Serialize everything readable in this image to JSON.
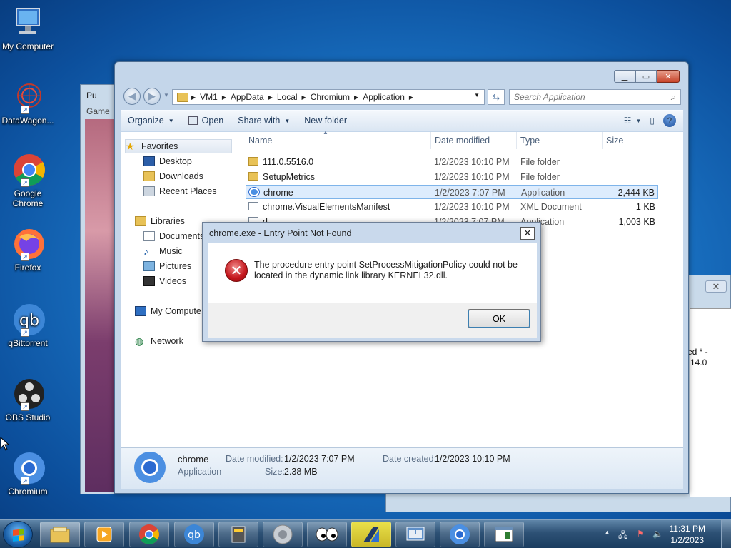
{
  "desktop": {
    "icons": [
      {
        "label": "My Computer"
      },
      {
        "label": "DataWagon..."
      },
      {
        "label": "Google Chrome"
      },
      {
        "label": "Firefox"
      },
      {
        "label": "qBittorrent"
      },
      {
        "label": "OBS Studio"
      },
      {
        "label": "Chromium"
      }
    ]
  },
  "bg_window_left": {
    "title": "Pu",
    "tab": "Game"
  },
  "bg_window_right": {
    "text1": "ed * -",
    "text2": "14.0"
  },
  "explorer": {
    "address": {
      "crumbs": [
        "VM1",
        "AppData",
        "Local",
        "Chromium",
        "Application"
      ]
    },
    "search_placeholder": "Search Application",
    "toolbar": {
      "organize": "Organize",
      "open": "Open",
      "share_with": "Share with",
      "new_folder": "New folder"
    },
    "nav": {
      "favorites": "Favorites",
      "desktop": "Desktop",
      "downloads": "Downloads",
      "recent_places": "Recent Places",
      "libraries": "Libraries",
      "documents": "Documents",
      "music": "Music",
      "pictures": "Pictures",
      "videos": "Videos",
      "my_computer": "My Compute",
      "network": "Network"
    },
    "columns": {
      "name": "Name",
      "date": "Date modified",
      "type": "Type",
      "size": "Size"
    },
    "files": [
      {
        "name": "111.0.5516.0",
        "date": "1/2/2023 10:10 PM",
        "type": "File folder",
        "size": ""
      },
      {
        "name": "SetupMetrics",
        "date": "1/2/2023 10:10 PM",
        "type": "File folder",
        "size": ""
      },
      {
        "name": "chrome",
        "date": "1/2/2023 7:07 PM",
        "type": "Application",
        "size": "2,444 KB"
      },
      {
        "name": "chrome.VisualElementsManifest",
        "date": "1/2/2023 10:10 PM",
        "type": "XML Document",
        "size": "1 KB"
      },
      {
        "name": "d",
        "date": "1/2/2023 7:07 PM",
        "type": "Application",
        "size": "1,003 KB"
      }
    ],
    "details": {
      "name": "chrome",
      "type": "Application",
      "modified_label": "Date modified:",
      "modified": "1/2/2023 7:07 PM",
      "created_label": "Date created:",
      "created": "1/2/2023 10:10 PM",
      "size_label": "Size:",
      "size": "2.38 MB"
    }
  },
  "dialog": {
    "title": "chrome.exe - Entry Point Not Found",
    "message": "The procedure entry point SetProcessMitigationPolicy could not be located in the dynamic link library KERNEL32.dll.",
    "ok": "OK",
    "close": "✕"
  },
  "taskbar": {
    "time": "11:31 PM",
    "date": "1/2/2023"
  }
}
